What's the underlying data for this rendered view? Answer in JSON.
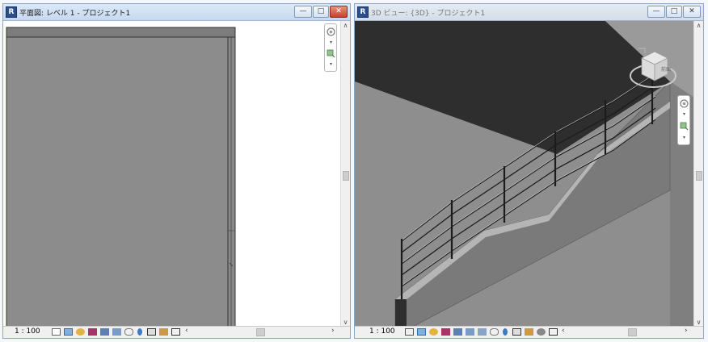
{
  "left_window": {
    "title": "平面図: レベル 1 - プロジェクト1",
    "app_icon": "R",
    "buttons": {
      "minimize": "—",
      "maximize": "□",
      "close": "✕"
    },
    "scale": "1 : 100",
    "scroll_left": "‹",
    "scroll_right": "›",
    "scroll_up": "∧",
    "scroll_down": "∨"
  },
  "right_window": {
    "title": "3D ビュー: {3D} - プロジェクト1",
    "app_icon": "R",
    "buttons": {
      "minimize": "—",
      "maximize": "□",
      "close": "✕"
    },
    "scale": "1 : 100",
    "scroll_left": "‹",
    "scroll_right": "›",
    "scroll_up": "∧",
    "scroll_down": "∨",
    "viewcube_label": "前面"
  },
  "colors": {
    "floor_gray": "#8a8a8a",
    "dark_wall": "#2f2f2f",
    "wall_gray": "#7a7a7a",
    "close_red": "#c5432c"
  },
  "icons": {
    "view_control_bar": [
      "model-graphics-icon",
      "visual-style-icon",
      "sun-path-icon",
      "shadows-icon",
      "render-icon",
      "crop-view-icon",
      "temporary-hide-icon",
      "reveal-hidden-icon",
      "analytical-model-icon",
      "highlight-displacement-icon"
    ],
    "navigation_bar": [
      "steering-wheel-icon",
      "zoom-icon"
    ]
  }
}
